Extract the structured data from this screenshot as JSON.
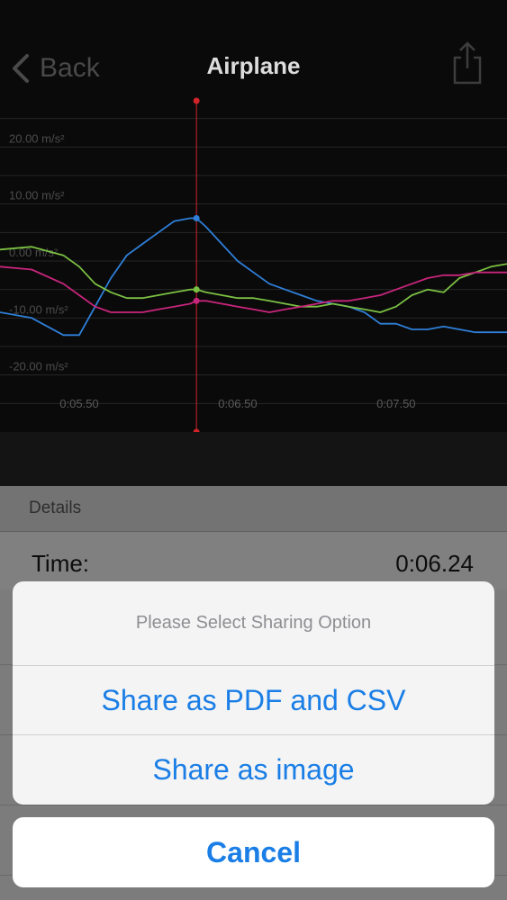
{
  "nav": {
    "back_label": "Back",
    "title": "Airplane"
  },
  "chart_data": {
    "type": "line",
    "y_tick_labels": [
      "20.00 m/s²",
      "10.00 m/s²",
      "0.00 m/s²",
      "-10.00 m/s²",
      "-20.00 m/s²"
    ],
    "y_ticks": [
      20,
      10,
      0,
      -10,
      -20
    ],
    "x_tick_labels": [
      "0:05.50",
      "0:06.50",
      "0:07.50"
    ],
    "x_ticks": [
      5.5,
      6.5,
      7.5
    ],
    "xlim": [
      5.0,
      8.2
    ],
    "ylim": [
      -30,
      30
    ],
    "cursor_x": 6.24,
    "grid": true,
    "series": [
      {
        "color": "#2f7fd8",
        "x": [
          5.0,
          5.2,
          5.4,
          5.5,
          5.6,
          5.7,
          5.8,
          5.9,
          6.0,
          6.1,
          6.2,
          6.24,
          6.3,
          6.4,
          6.5,
          6.6,
          6.7,
          6.8,
          6.9,
          7.0,
          7.1,
          7.2,
          7.3,
          7.4,
          7.5,
          7.6,
          7.7,
          7.8,
          7.9,
          8.0,
          8.1,
          8.2
        ],
        "values": [
          -9,
          -10,
          -13,
          -13,
          -8,
          -3,
          1,
          3,
          5,
          7,
          7.5,
          7.5,
          6,
          3,
          0,
          -2,
          -4,
          -5,
          -6,
          -7,
          -7.5,
          -8,
          -9,
          -11,
          -11,
          -12,
          -12,
          -11.5,
          -12,
          -12.5,
          -12.5,
          -12.5
        ]
      },
      {
        "color": "#7bc043",
        "x": [
          5.0,
          5.2,
          5.4,
          5.5,
          5.6,
          5.7,
          5.8,
          5.9,
          6.0,
          6.1,
          6.2,
          6.24,
          6.3,
          6.4,
          6.5,
          6.6,
          6.7,
          6.8,
          6.9,
          7.0,
          7.1,
          7.2,
          7.3,
          7.4,
          7.5,
          7.6,
          7.7,
          7.8,
          7.9,
          8.0,
          8.1,
          8.2
        ],
        "values": [
          2,
          2.5,
          1,
          -1,
          -4,
          -5.5,
          -6.5,
          -6.5,
          -6,
          -5.5,
          -5,
          -5,
          -5.5,
          -6,
          -6.5,
          -6.5,
          -7,
          -7.5,
          -8,
          -8,
          -7.5,
          -8,
          -8.5,
          -9,
          -8,
          -6,
          -5,
          -5.5,
          -3,
          -2,
          -1,
          -0.5
        ]
      },
      {
        "color": "#c8257c",
        "x": [
          5.0,
          5.2,
          5.4,
          5.5,
          5.6,
          5.7,
          5.8,
          5.9,
          6.0,
          6.1,
          6.2,
          6.24,
          6.3,
          6.4,
          6.5,
          6.6,
          6.7,
          6.8,
          6.9,
          7.0,
          7.1,
          7.2,
          7.3,
          7.4,
          7.5,
          7.6,
          7.7,
          7.8,
          7.9,
          8.0,
          8.1,
          8.2
        ],
        "values": [
          -1,
          -1.5,
          -4,
          -6,
          -8,
          -9,
          -9,
          -9,
          -8.5,
          -8,
          -7.5,
          -7,
          -7,
          -7.5,
          -8,
          -8.5,
          -9,
          -8.5,
          -8,
          -7.5,
          -7,
          -7,
          -6.5,
          -6,
          -5,
          -4,
          -3,
          -2.5,
          -2.5,
          -2,
          -2,
          -2
        ]
      }
    ]
  },
  "details": {
    "header": "Details",
    "time_label": "Time:",
    "time_value": "0:06.24"
  },
  "sheet": {
    "title": "Please Select Sharing Option",
    "option_pdf_csv": "Share as PDF and CSV",
    "option_image": "Share as image",
    "cancel": "Cancel"
  },
  "colors": {
    "accent": "#1a7ee6",
    "cursor": "#d0242a"
  },
  "icons": {
    "back": "chevron-left-icon",
    "share": "share-icon"
  }
}
